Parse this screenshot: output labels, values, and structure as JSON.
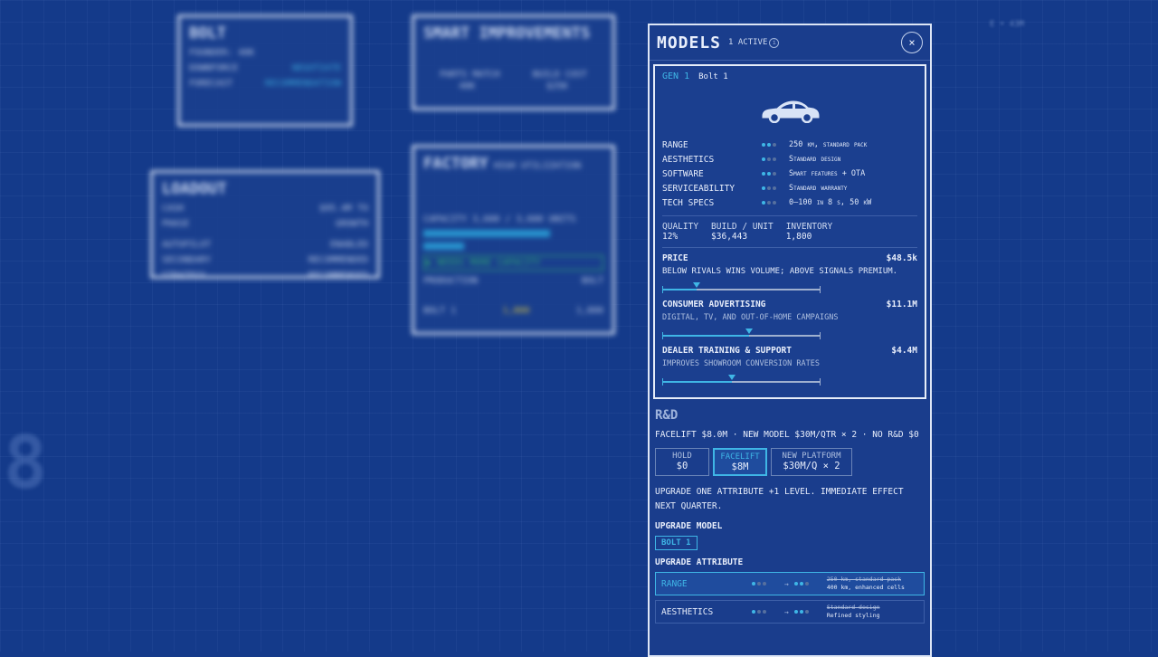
{
  "panel": {
    "title": "MODELS",
    "badge": "1 ACTIVE",
    "close": "×"
  },
  "model_card": {
    "gen": "GEN 1",
    "model": "Bolt 1",
    "attributes": [
      {
        "name": "RANGE",
        "level": 2,
        "value": "250 km, standard pack"
      },
      {
        "name": "AESTHETICS",
        "level": 1,
        "value": "Standard design"
      },
      {
        "name": "SOFTWARE",
        "level": 2,
        "value": "Smart features + OTA"
      },
      {
        "name": "SERVICEABILITY",
        "level": 1,
        "value": "Standard warranty"
      },
      {
        "name": "TECH SPECS",
        "level": 1,
        "value": "0–100 in 8 s, 50 kW"
      }
    ],
    "stats": [
      {
        "label": "QUALITY",
        "value": "12%"
      },
      {
        "label": "BUILD / UNIT",
        "value": "$36,443"
      },
      {
        "label": "INVENTORY",
        "value": "1,800"
      }
    ],
    "sliders": [
      {
        "name": "PRICE",
        "amount": "$48.5k",
        "desc": "BELOW RIVALS WINS VOLUME; ABOVE SIGNALS PREMIUM.",
        "level": 0.22,
        "bright": true
      },
      {
        "name": "CONSUMER ADVERTISING",
        "amount": "$11.1M",
        "desc": "DIGITAL, TV, AND OUT-OF-HOME CAMPAIGNS",
        "level": 0.55,
        "bright": false
      },
      {
        "name": "DEALER TRAINING & SUPPORT",
        "amount": "$4.4M",
        "desc": "IMPROVES SHOWROOM CONVERSION RATES",
        "level": 0.44,
        "bright": false
      }
    ]
  },
  "rd": {
    "title": "R&D",
    "summary": "FACELIFT $8.0M · NEW MODEL $30M/QTR × 2 · NO R&D $0",
    "options": [
      {
        "label": "HOLD",
        "price": "$0",
        "active": false
      },
      {
        "label": "FACELIFT",
        "price": "$8M",
        "active": true
      },
      {
        "label": "NEW PLATFORM",
        "price": "$30M/Q × 2",
        "active": false
      }
    ],
    "desc": "UPGRADE ONE ATTRIBUTE +1 LEVEL. IMMEDIATE EFFECT NEXT QUARTER.",
    "upgrade_model_label": "UPGRADE MODEL",
    "upgrade_model_chip": "BOLT 1",
    "upgrade_attr_label": "UPGRADE ATTRIBUTE",
    "upgrades": [
      {
        "name": "RANGE",
        "old": "250 km, standard pack",
        "new": "400 km, enhanced cells",
        "active": true
      },
      {
        "name": "AESTHETICS",
        "old": "Standard design",
        "new": "Refined styling",
        "active": false
      }
    ]
  },
  "background": {
    "card1": {
      "title": "BOLT",
      "r1": "FOUNDER: 40K",
      "r2a": "DOWNFORCE",
      "r2b": "NEGOTIATE",
      "r3a": "FORECAST",
      "r3b": "RECOMMENDATION"
    },
    "card2": {
      "title": "SMART IMPROVEMENTS",
      "g1a": "PARTS MATCH",
      "g1b": "40K",
      "g2a": "BUILD COST",
      "g2b": "$25K"
    },
    "card3": {
      "title": "LOADOUT",
      "r1a": "CASH",
      "r1b": "$95.4M TO",
      "r2a": "PHASE",
      "r2b": "GROWTH",
      "r3a": "AUTOPILOT",
      "r3b": "ENABLED",
      "r4a": "SECONDARY",
      "r4b": "RECOMMENDED",
      "r5a": "STRATEGY",
      "r5b": "RECOMMENDED"
    },
    "card4": {
      "title": "FACTORY",
      "sub": "HIGH UTILIZATION",
      "r1": "CAPACITY  3,600 / 3,600 UNITS",
      "r2": "▶ NEEDS MORE CAPACITY",
      "r3a": "PRODUCTION",
      "r3b": "BOLT",
      "r4a": "1,800",
      "r4b": "1,800",
      "r5": "BOLT 1"
    },
    "big": "8",
    "corner": "E • 43M"
  }
}
